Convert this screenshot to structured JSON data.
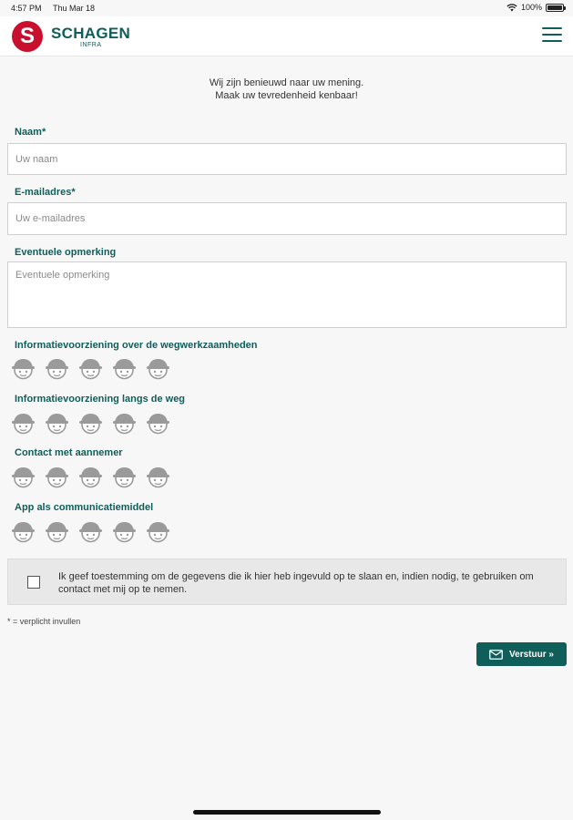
{
  "status": {
    "time": "4:57 PM",
    "date": "Thu Mar 18",
    "battery": "100%"
  },
  "header": {
    "brand": "SCHAGEN",
    "subbrand": "INFRA",
    "logo_letter": "S"
  },
  "intro": {
    "line1": "Wij zijn benieuwd naar uw mening.",
    "line2": "Maak uw tevredenheid kenbaar!"
  },
  "form": {
    "name": {
      "label": "Naam*",
      "placeholder": "Uw naam"
    },
    "email": {
      "label": "E-mailadres*",
      "placeholder": "Uw e-mailadres"
    },
    "remark": {
      "label": "Eventuele opmerking",
      "placeholder": "Eventuele opmerking"
    }
  },
  "ratings": [
    {
      "label": "Informatievoorziening over de wegwerkzaamheden",
      "value": 0,
      "max": 5
    },
    {
      "label": "Informatievoorziening langs de weg",
      "value": 0,
      "max": 5
    },
    {
      "label": "Contact met aannemer",
      "value": 0,
      "max": 5
    },
    {
      "label": "App als communicatiemiddel",
      "value": 0,
      "max": 5
    }
  ],
  "consent": {
    "text": "Ik geef toestemming om de gegevens die ik hier heb ingevuld op te slaan en, indien nodig, te gebruiken om contact met mij op te nemen.",
    "checked": false
  },
  "required_note": "* = verplicht invullen",
  "submit": {
    "label": "Verstuur »"
  },
  "colors": {
    "accent": "#0f5e59",
    "logo": "#c8102e",
    "icon_gray": "#9a9a9a"
  }
}
